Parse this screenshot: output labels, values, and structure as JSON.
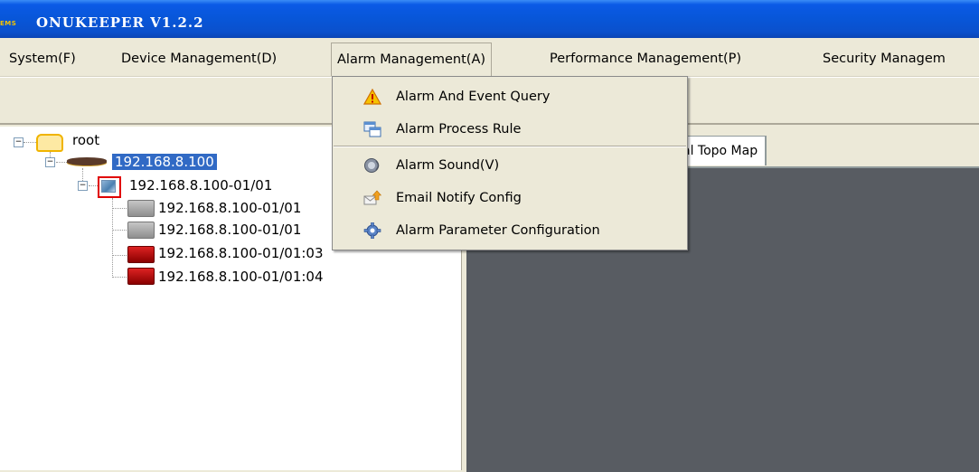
{
  "app": {
    "logo_text": "EMS",
    "title": "ONUKEEPER V1.2.2"
  },
  "menubar": {
    "items": [
      {
        "label": "System(F)",
        "mnemonic": "F"
      },
      {
        "label": "Device Management(D)",
        "mnemonic": "D"
      },
      {
        "label": "Alarm Management(A)",
        "mnemonic": "A"
      },
      {
        "label": "Performance Management(P)",
        "mnemonic": "P"
      },
      {
        "label": "Security Managem",
        "mnemonic": "S"
      }
    ]
  },
  "tree": {
    "root_label": "root",
    "olt_label": "192.168.8.100",
    "board_label": "192.168.8.100-01/01",
    "onus": [
      {
        "label": "192.168.8.100-01/01",
        "status": "offline-gray"
      },
      {
        "label": "192.168.8.100-01/01",
        "status": "offline-gray"
      },
      {
        "label": "192.168.8.100-01/01:03",
        "status": "alarm-red"
      },
      {
        "label": "192.168.8.100-01/01:04",
        "status": "alarm-red"
      }
    ]
  },
  "tabs": {
    "active_label": "al Topo Map"
  },
  "alarm_menu": {
    "items": [
      {
        "label": "Alarm And Event Query",
        "icon": "warning-icon"
      },
      {
        "label": "Alarm Process Rule",
        "icon": "rule-window-icon"
      },
      {
        "label": "Alarm Sound(V)",
        "icon": "speaker-icon"
      },
      {
        "label": "Email Notify Config",
        "icon": "email-arrow-icon"
      },
      {
        "label": "Alarm Parameter Configuration",
        "icon": "gear-icon"
      }
    ]
  },
  "colors": {
    "titlebar": "#0a5ae6",
    "selection": "#316ac5",
    "canvas": "#585c62",
    "alarm_red": "#cc0000"
  }
}
